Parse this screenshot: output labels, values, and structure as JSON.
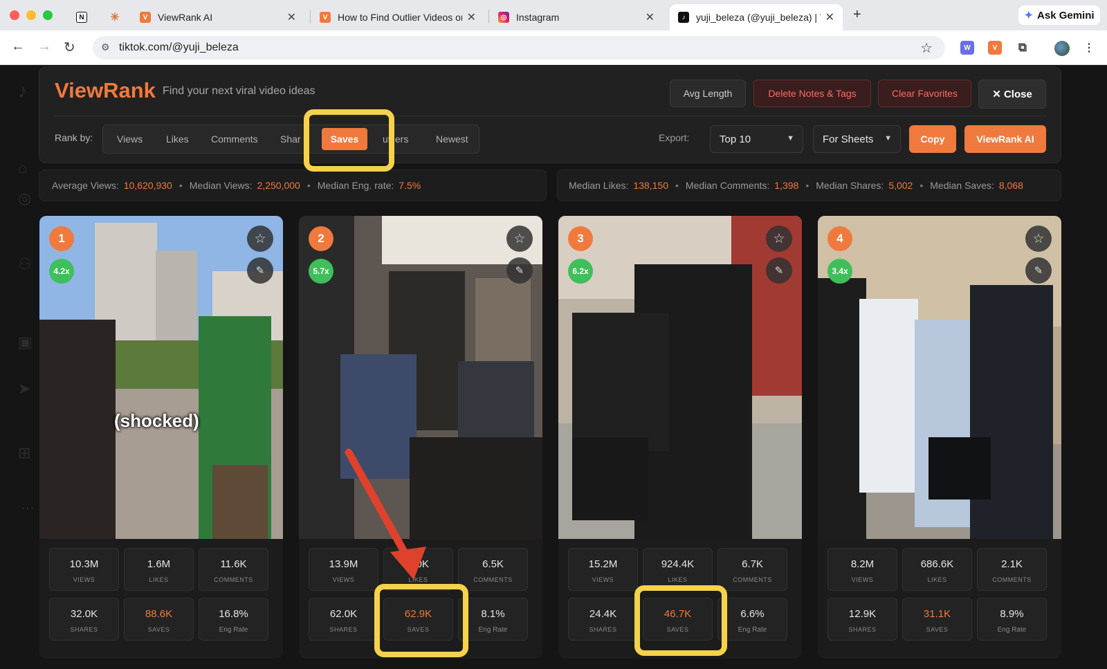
{
  "browser": {
    "tabs": [
      {
        "title": "",
        "icon": "notion-icon"
      },
      {
        "title": "",
        "icon": "claude-icon"
      },
      {
        "title": "ViewRank AI",
        "icon": "viewrank-icon"
      },
      {
        "title": "How to Find Outlier Videos on",
        "icon": "viewrank-icon"
      },
      {
        "title": "Instagram",
        "icon": "instagram-icon"
      },
      {
        "title": "yuji_beleza (@yuji_beleza) | T",
        "icon": "tiktok-icon"
      }
    ],
    "new_tab": "+",
    "gemini_label": "Ask Gemini",
    "url": "tiktok.com/@yuji_beleza"
  },
  "panel": {
    "brand": "ViewRank",
    "tagline": "Find your next viral video ideas",
    "avg_length": "Avg Length",
    "delete_notes": "Delete Notes & Tags",
    "clear_favorites": "Clear Favorites",
    "close": "✕ Close",
    "rank_by_label": "Rank by:",
    "rank_options": [
      "Views",
      "Likes",
      "Comments",
      "Share",
      "Saves",
      "utliers",
      "Newest"
    ],
    "active_rank": "Saves",
    "export_label": "Export:",
    "export_count": "Top 10",
    "export_format": "For Sheets",
    "copy": "Copy",
    "viewrank_ai": "ViewRank AI"
  },
  "stats": {
    "average_views_label": "Average Views:",
    "average_views": "10,620,930",
    "median_views_label": "Median Views:",
    "median_views": "2,250,000",
    "median_eng_label": "Median Eng. rate:",
    "median_eng": "7.5%",
    "median_likes_label": "Median Likes:",
    "median_likes": "138,150",
    "median_comments_label": "Median Comments:",
    "median_comments": "1,398",
    "median_shares_label": "Median Shares:",
    "median_shares": "5,002",
    "median_saves_label": "Median Saves:",
    "median_saves": "8,068"
  },
  "labels": {
    "views": "VIEWS",
    "likes": "LIKES",
    "comments": "COMMENTS",
    "shares": "SHARES",
    "saves": "SAVES",
    "eng": "Eng Rate"
  },
  "videos": [
    {
      "rank": "1",
      "multiplier": "4.2x",
      "caption": "(shocked)",
      "views": "10.3M",
      "likes": "1.6M",
      "comments": "11.6K",
      "shares": "32.0K",
      "saves": "88.6K",
      "eng": "16.8%"
    },
    {
      "rank": "2",
      "multiplier": "5.7x",
      "caption": "",
      "views": "13.9M",
      "likes": "9.0K",
      "comments": "6.5K",
      "shares": "62.0K",
      "saves": "62.9K",
      "eng": "8.1%"
    },
    {
      "rank": "3",
      "multiplier": "6.2x",
      "caption": "",
      "views": "15.2M",
      "likes": "924.4K",
      "comments": "6.7K",
      "shares": "24.4K",
      "saves": "46.7K",
      "eng": "6.6%"
    },
    {
      "rank": "4",
      "multiplier": "3.4x",
      "caption": "",
      "views": "8.2M",
      "likes": "686.6K",
      "comments": "2.1K",
      "shares": "12.9K",
      "saves": "31.1K",
      "eng": "8.9%"
    }
  ],
  "colors": {
    "accent": "#f07a3d",
    "multiplier": "#3fbf5a",
    "highlight": "#f5d24a",
    "arrow": "#e0412c"
  }
}
